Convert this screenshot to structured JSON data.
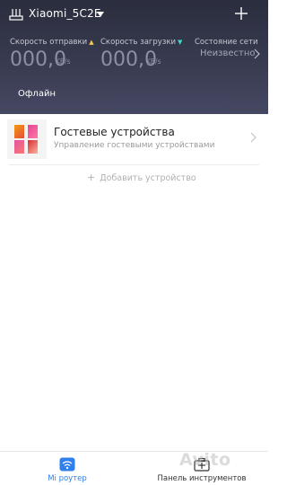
{
  "header": {
    "title": "Xiaomi_5C2E",
    "stats": [
      {
        "label": "Скорость отправки",
        "value": "000,0",
        "unit": "KB/s"
      },
      {
        "label": "Скорость загрузки",
        "value": "000,0",
        "unit": "KB/s"
      }
    ],
    "network": {
      "label": "Состояние сети",
      "value": "Неизвестно"
    },
    "status": "Офлайн"
  },
  "guest_card": {
    "title": "Гостевые устройства",
    "subtitle": "Управление гостевыми устройствами"
  },
  "add_device": {
    "label": "Добавить устройство"
  },
  "bottom_nav": [
    {
      "label": "Mi роутер",
      "icon": "wifi-icon",
      "active": true
    },
    {
      "label": "Панель инструментов",
      "icon": "toolbox-icon",
      "active": false
    }
  ],
  "colors": {
    "header_bg": "#2a2d3d",
    "accent": "#2f80ed",
    "upload_arrow": "#f2c94c",
    "download_arrow": "#3fd6c8"
  },
  "watermark": {
    "text": "Avito"
  }
}
